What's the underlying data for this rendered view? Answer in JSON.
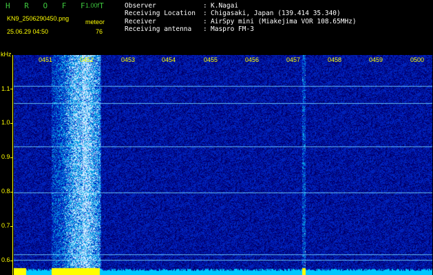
{
  "header": {
    "brand": "H R O F F T",
    "version": "1.00f",
    "filename": "KN9_2506290450.png",
    "meteor_label": "meteor",
    "datetime": "25.06.29 04:50",
    "meteor_count": "76"
  },
  "info": [
    {
      "key": "Observer",
      "sep": ":",
      "value": "K.Nagai"
    },
    {
      "key": "Receiving Location",
      "sep": ":",
      "value": "Chigasaki, Japan (139.414 35.340)"
    },
    {
      "key": "Receiver",
      "sep": ":",
      "value": "AirSpy mini (Miakejima VOR 108.65MHz)"
    },
    {
      "key": "Receiving antenna",
      "sep": ":",
      "value": "Maspro FM-3"
    }
  ],
  "axes": {
    "unit": "kHz",
    "frequency_ticks": [
      "1.1",
      "1.0",
      "0.9",
      "0.8",
      "0.7",
      "0.6"
    ],
    "time_ticks": [
      "0451",
      "0452",
      "0453",
      "0454",
      "0455",
      "0456",
      "0457",
      "0458",
      "0459",
      "0500"
    ]
  },
  "colors": {
    "background": "#000000",
    "label": "#ffff00",
    "brand": "#3ec93e",
    "noise": "#0a1c8c",
    "signal": "#38c8ff"
  }
}
